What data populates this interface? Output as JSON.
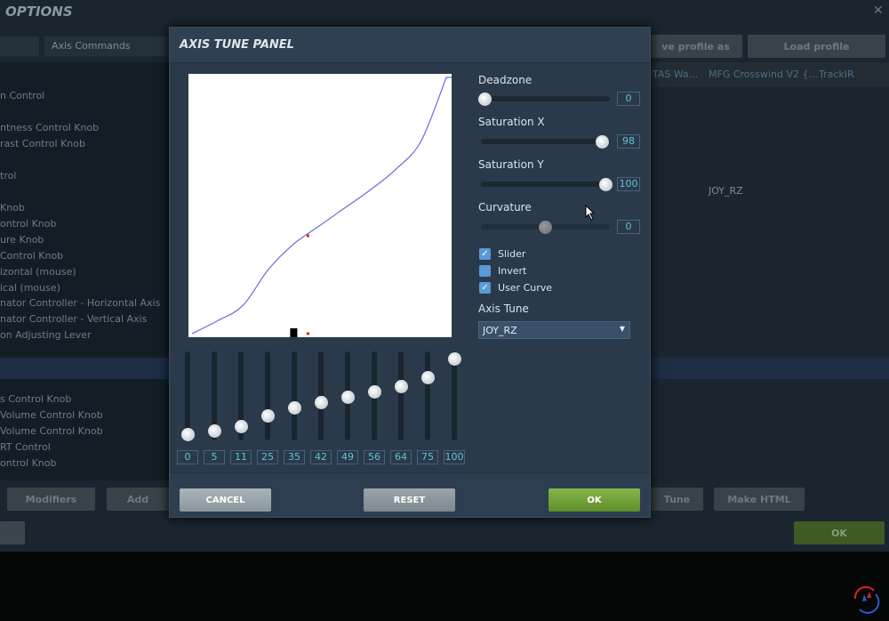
{
  "background": {
    "title": "OPTIONS",
    "close": "✕",
    "category_select": "Axis Commands",
    "save_profile_as": "ve profile as",
    "load_profile": "Load profile",
    "columns": [
      "TAS Wa...",
      "MFG Crosswind V2 {...",
      "TrackIR"
    ],
    "assigned_value": "JOY_RZ",
    "list_items": [
      "n Control",
      "ntness Control Knob",
      "rast Control Knob",
      "trol",
      "Knob",
      "ontrol Knob",
      "ure Knob",
      "Control Knob",
      "izontal (mouse)",
      "ical (mouse)",
      "nator Controller - Horizontal Axis",
      "nator Controller - Vertical Axis",
      "on Adjusting Lever",
      "s Control Knob",
      "Volume Control Knob",
      "Volume Control Knob",
      "RT Control",
      "ontrol Knob"
    ],
    "modifiers": "Modifiers",
    "add": "Add",
    "axis_tune": "Tune",
    "make_html": "Make HTML",
    "ok": "OK"
  },
  "dialog": {
    "title": "AXIS TUNE PANEL",
    "deadzone": {
      "label": "Deadzone",
      "value": "0"
    },
    "saturation_x": {
      "label": "Saturation X",
      "value": "98"
    },
    "saturation_y": {
      "label": "Saturation Y",
      "value": "100"
    },
    "curvature": {
      "label": "Curvature",
      "value": "0"
    },
    "checkboxes": [
      {
        "label": "Slider",
        "checked": true
      },
      {
        "label": "Invert",
        "checked": false
      },
      {
        "label": "User Curve",
        "checked": true
      }
    ],
    "axis_tune_label": "Axis Tune",
    "axis_tune_value": "JOY_RZ",
    "curve_points": [
      "0",
      "5",
      "11",
      "25",
      "35",
      "42",
      "49",
      "56",
      "64",
      "75",
      "100"
    ],
    "cancel": "CANCEL",
    "reset": "RESET",
    "ok": "OK"
  },
  "chart_data": {
    "type": "line",
    "title": "User Curve",
    "x": [
      0,
      10,
      20,
      30,
      40,
      50,
      60,
      70,
      80,
      90,
      100
    ],
    "values": [
      0,
      5,
      11,
      25,
      35,
      42,
      49,
      56,
      64,
      75,
      100
    ],
    "xlim": [
      0,
      100
    ],
    "ylim": [
      0,
      100
    ],
    "current_input": 40
  },
  "colors": {
    "accent": "#5ec3d6",
    "ok_green": "#6a9a34",
    "curve": "#6a6adf",
    "marker": "#e02020"
  }
}
